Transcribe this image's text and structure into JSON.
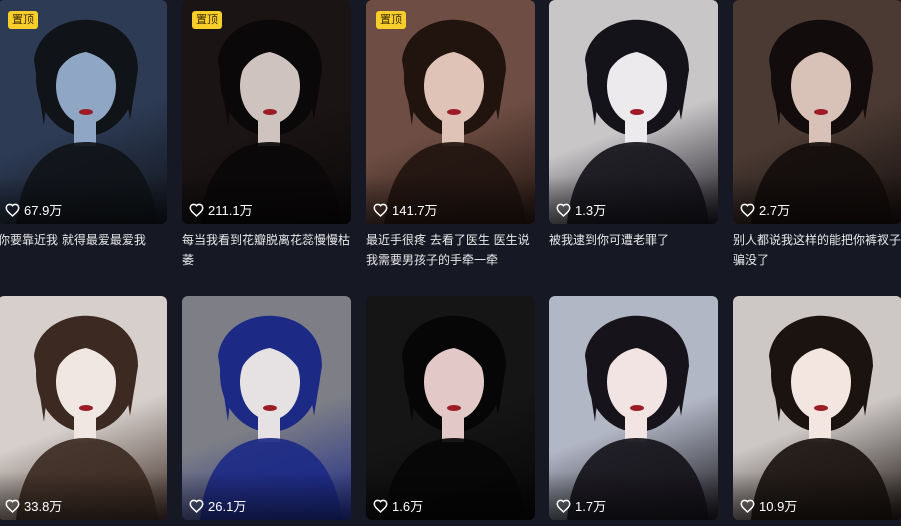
{
  "videos": [
    {
      "pinned": true,
      "pin_label": "置顶",
      "likes": "67.9万",
      "caption": "你要靠近我 就得最爱最爱我",
      "colors": [
        "#2d3b55",
        "#8fa6c4",
        "#101318"
      ]
    },
    {
      "pinned": true,
      "pin_label": "置顶",
      "likes": "211.1万",
      "caption": "每当我看到花瓣脱离花蕊慢慢枯萎",
      "colors": [
        "#1b1414",
        "#cfc3c0",
        "#0a0809"
      ]
    },
    {
      "pinned": true,
      "pin_label": "置顶",
      "likes": "141.7万",
      "caption": "最近手很疼 去看了医生 医生说我需要男孩子的手牵一牵",
      "colors": [
        "#6e4e44",
        "#e0c3b7",
        "#21140f"
      ]
    },
    {
      "pinned": false,
      "pin_label": "",
      "likes": "1.3万",
      "caption": "被我逮到你可遭老罪了",
      "colors": [
        "#c9c6c8",
        "#eceaec",
        "#15131a"
      ]
    },
    {
      "pinned": false,
      "pin_label": "",
      "likes": "2.7万",
      "caption": "别人都说我这样的能把你裤衩子骗没了",
      "colors": [
        "#4b3a33",
        "#d8c1b6",
        "#120d0c"
      ]
    },
    {
      "pinned": false,
      "pin_label": "",
      "likes": "33.8万",
      "caption": "",
      "colors": [
        "#d6cfcb",
        "#f0e7e2",
        "#3c2a22"
      ]
    },
    {
      "pinned": false,
      "pin_label": "",
      "likes": "26.1万",
      "caption": "",
      "colors": [
        "#7e7f86",
        "#e6e2e4",
        "#1c2a86"
      ]
    },
    {
      "pinned": false,
      "pin_label": "",
      "likes": "1.6万",
      "caption": "",
      "colors": [
        "#151515",
        "#e2c8c6",
        "#060606"
      ]
    },
    {
      "pinned": false,
      "pin_label": "",
      "likes": "1.7万",
      "caption": "",
      "colors": [
        "#b2b7c6",
        "#f2e4e2",
        "#16141a"
      ]
    },
    {
      "pinned": false,
      "pin_label": "",
      "likes": "10.9万",
      "caption": "",
      "colors": [
        "#cdc8c6",
        "#f3e5df",
        "#1a1310"
      ]
    }
  ]
}
